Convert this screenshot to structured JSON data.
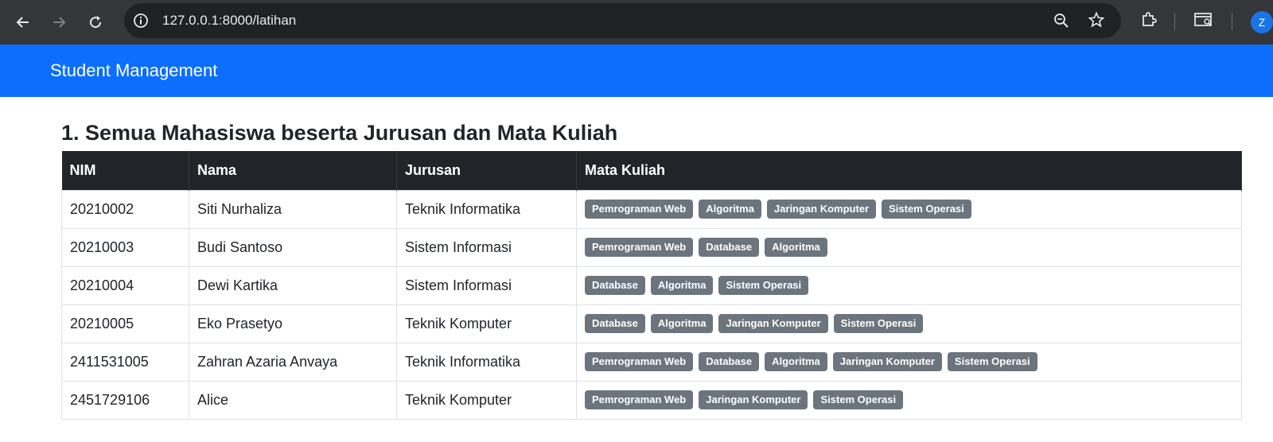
{
  "browser": {
    "url": "127.0.0.1:8000/latihan",
    "profile_initial": "Z"
  },
  "navbar": {
    "brand": "Student Management",
    "color": "#0d6efd"
  },
  "section": {
    "title": "1. Semua Mahasiswa beserta Jurusan dan Mata Kuliah"
  },
  "table": {
    "headers": [
      "NIM",
      "Nama",
      "Jurusan",
      "Mata Kuliah"
    ],
    "rows": [
      {
        "nim": "20210002",
        "nama": "Siti Nurhaliza",
        "jurusan": "Teknik Informatika",
        "mata_kuliah": [
          "Pemrograman Web",
          "Algoritma",
          "Jaringan Komputer",
          "Sistem Operasi"
        ]
      },
      {
        "nim": "20210003",
        "nama": "Budi Santoso",
        "jurusan": "Sistem Informasi",
        "mata_kuliah": [
          "Pemrograman Web",
          "Database",
          "Algoritma"
        ]
      },
      {
        "nim": "20210004",
        "nama": "Dewi Kartika",
        "jurusan": "Sistem Informasi",
        "mata_kuliah": [
          "Database",
          "Algoritma",
          "Sistem Operasi"
        ]
      },
      {
        "nim": "20210005",
        "nama": "Eko Prasetyo",
        "jurusan": "Teknik Komputer",
        "mata_kuliah": [
          "Database",
          "Algoritma",
          "Jaringan Komputer",
          "Sistem Operasi"
        ]
      },
      {
        "nim": "2411531005",
        "nama": "Zahran Azaria Anvaya",
        "jurusan": "Teknik Informatika",
        "mata_kuliah": [
          "Pemrograman Web",
          "Database",
          "Algoritma",
          "Jaringan Komputer",
          "Sistem Operasi"
        ]
      },
      {
        "nim": "2451729106",
        "nama": "Alice",
        "jurusan": "Teknik Komputer",
        "mata_kuliah": [
          "Pemrograman Web",
          "Jaringan Komputer",
          "Sistem Operasi"
        ]
      }
    ]
  }
}
